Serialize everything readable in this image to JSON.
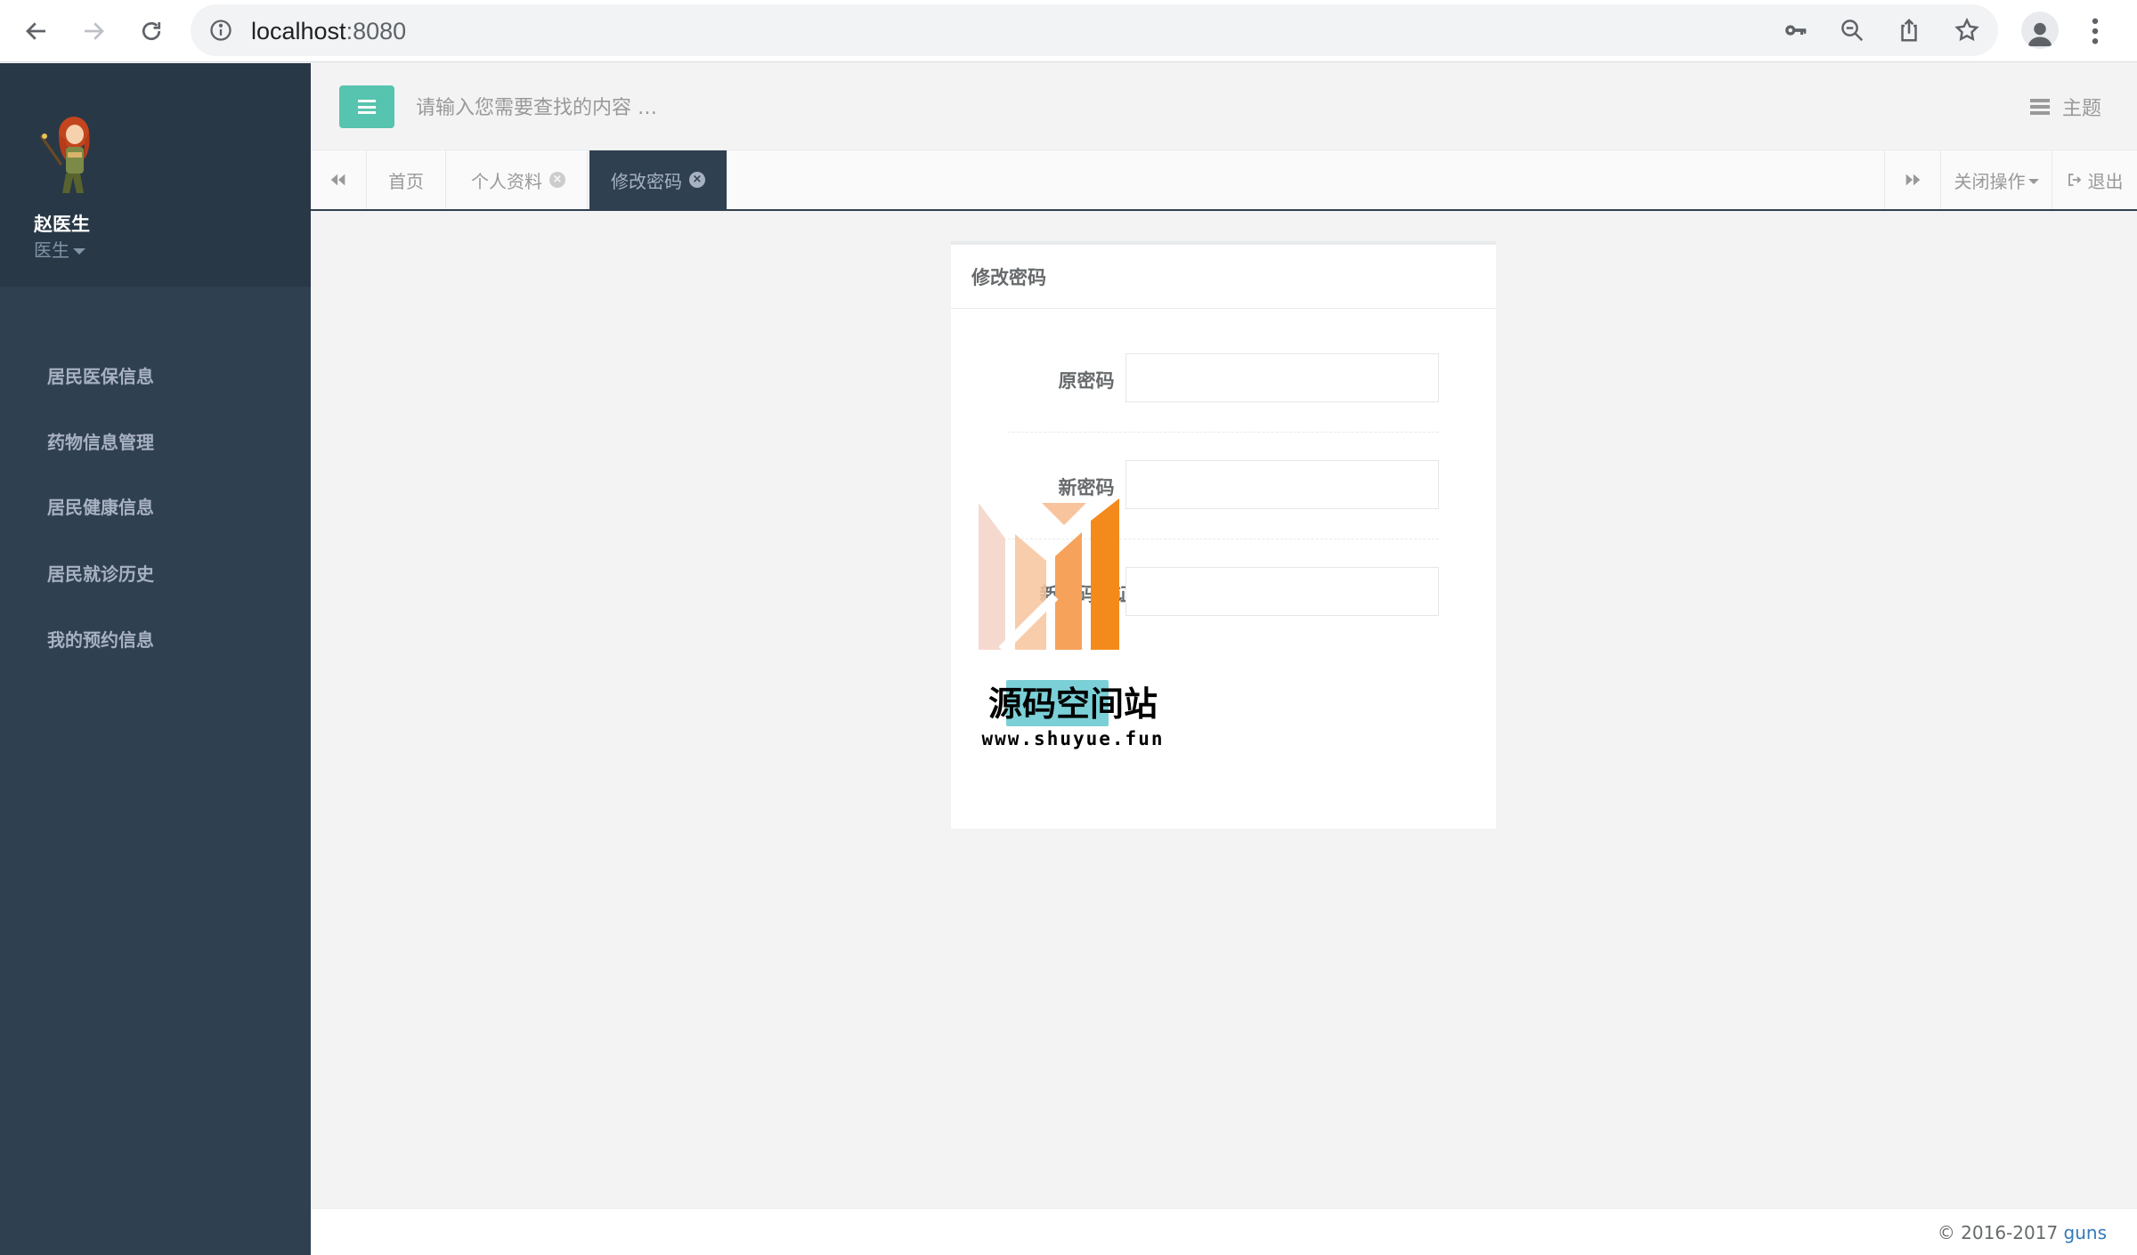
{
  "browser": {
    "url_host": "localhost",
    "url_port": ":8080"
  },
  "sidebar": {
    "user_name": "赵医生",
    "user_role": "医生",
    "items": [
      {
        "label": "居民医保信息"
      },
      {
        "label": "药物信息管理"
      },
      {
        "label": "居民健康信息"
      },
      {
        "label": "居民就诊历史"
      },
      {
        "label": "我的预约信息"
      }
    ]
  },
  "topbar": {
    "search_placeholder": "请输入您需要查找的内容 …",
    "theme_label": "主题"
  },
  "tabs": {
    "items": [
      {
        "label": "首页"
      },
      {
        "label": "个人资料"
      },
      {
        "label": "修改密码"
      }
    ],
    "close_ops_label": "关闭操作",
    "logout_label": "退出"
  },
  "panel": {
    "title": "修改密码",
    "fields": [
      {
        "label": "原密码"
      },
      {
        "label": "新密码"
      },
      {
        "label": "新密码验证"
      }
    ]
  },
  "watermark": {
    "text": "源码空间站",
    "url": "www.shuyue.fun"
  },
  "footer": {
    "copyright": "© 2016-2017 ",
    "link": "guns"
  },
  "colors": {
    "sidebar_bg": "#2f4050",
    "accent": "#1ab394",
    "active_tab": "#2f4050"
  }
}
